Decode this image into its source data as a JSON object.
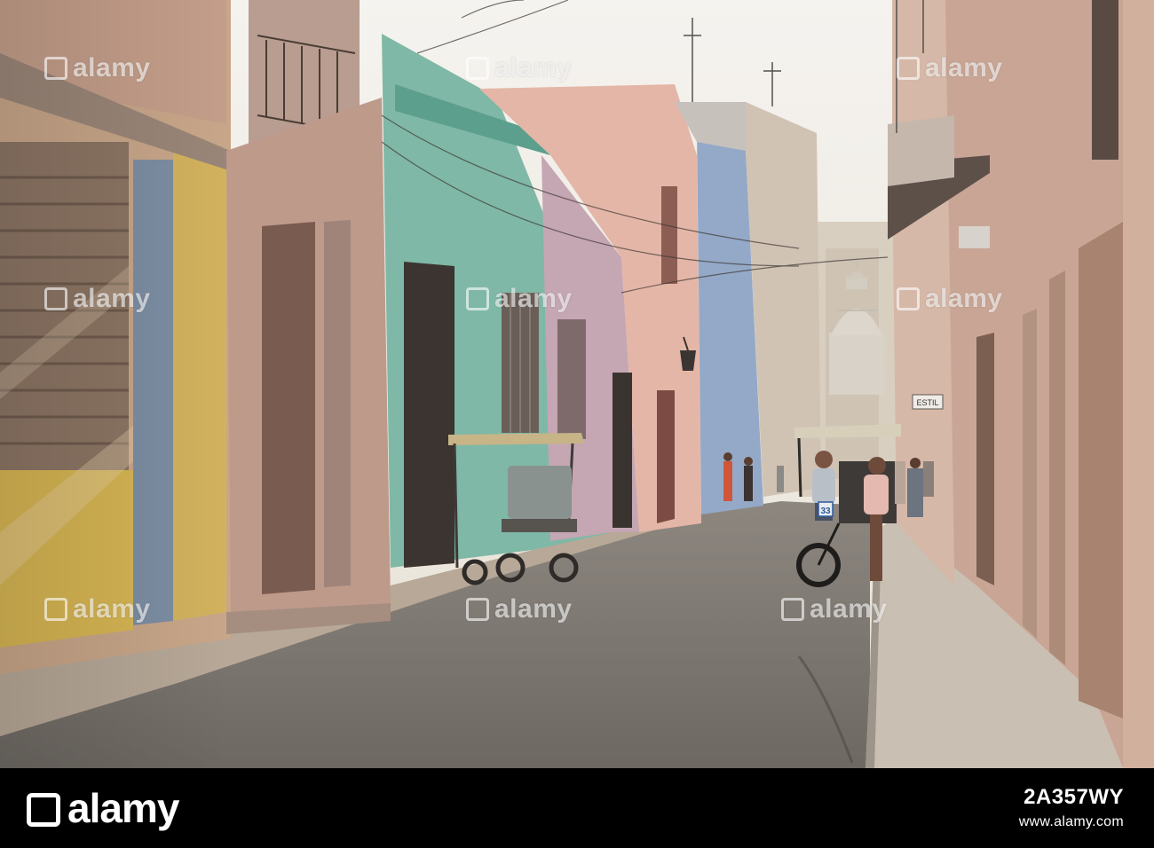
{
  "photo": {
    "description_name": "havana-street-scene",
    "sign_text": "ESTIL",
    "bike_number": "33",
    "watermark_text": "alamy"
  },
  "footer": {
    "brand": "alamy",
    "image_id": "2A357WY",
    "site_url": "www.alamy.com"
  },
  "colors": {
    "footer_bg": "#000000",
    "sky": "#f1eee8",
    "street": "#77716a"
  }
}
